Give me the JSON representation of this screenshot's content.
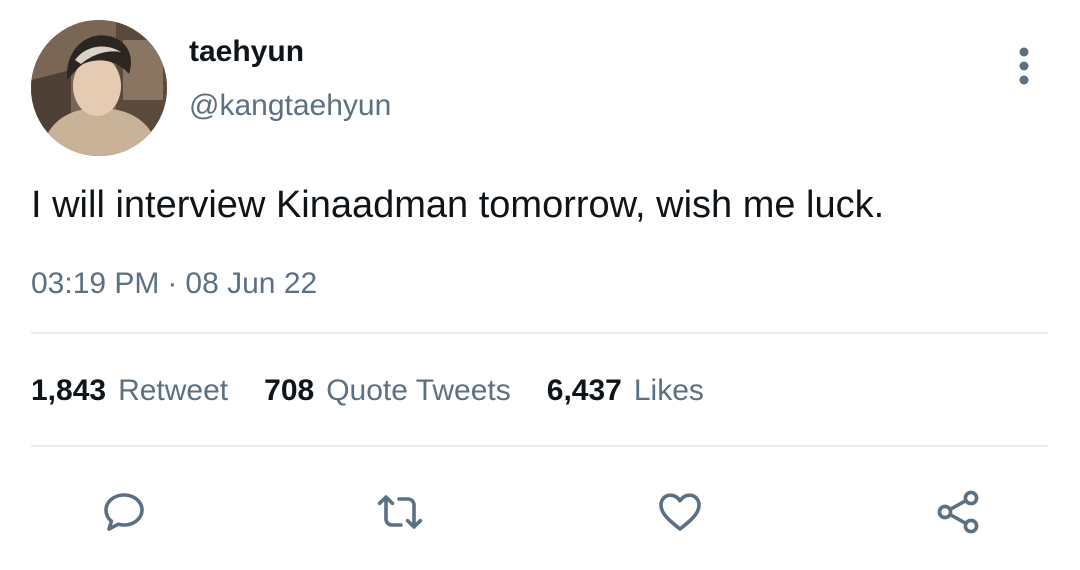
{
  "author": {
    "display_name": "taehyun",
    "handle": "@kangtaehyun"
  },
  "tweet": {
    "text": "I will interview Kinaadman tomorrow, wish me luck.",
    "time": "03:19 PM",
    "separator": "·",
    "date": "08 Jun 22"
  },
  "stats": [
    {
      "count": "1,843",
      "label": "Retweet"
    },
    {
      "count": "708",
      "label": "Quote Tweets"
    },
    {
      "count": "6,437",
      "label": "Likes"
    }
  ],
  "actions": {
    "reply_icon": "reply-icon",
    "retweet_icon": "retweet-icon",
    "like_icon": "heart-icon",
    "share_icon": "share-icon"
  },
  "colors": {
    "text_primary": "#0f1419",
    "text_secondary": "#5b7083",
    "divider": "#e6ecf0"
  }
}
